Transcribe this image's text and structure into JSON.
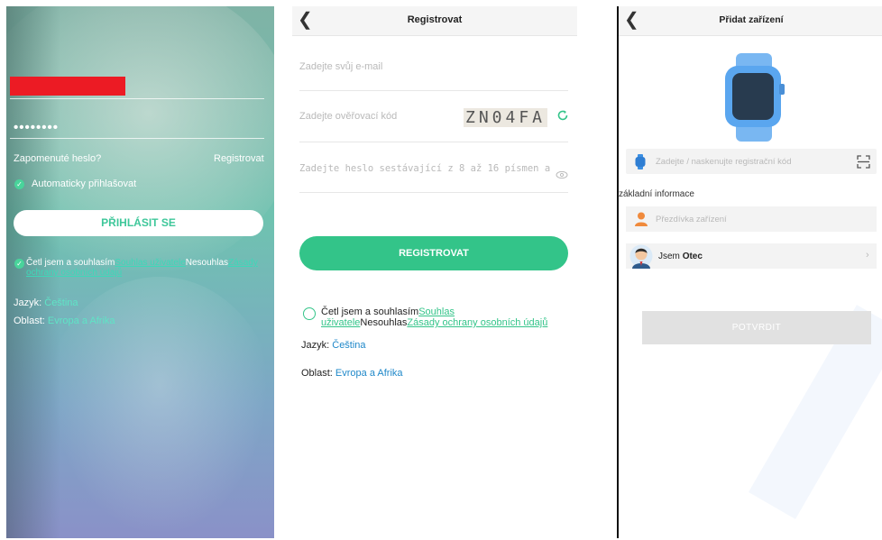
{
  "login": {
    "password_mask": "••••••••",
    "forgot_password": "Zapomenuté heslo?",
    "register_link": "Registrovat",
    "auto_login": "Automaticky přihlašovat",
    "login_button": "PŘIHLÁSIT SE",
    "agree_prefix": "Četl jsem a souhlasím",
    "agree_link1": "Souhlas uživatele",
    "agree_mid": "Nesouhlas",
    "agree_link2": "Zásady ochrany osobních údajů",
    "language_label": "Jazyk:",
    "language_value": "Čeština",
    "region_label": "Oblast:",
    "region_value": "Evropa a Afrika"
  },
  "register": {
    "title": "Registrovat",
    "email_placeholder": "Zadejte svůj e-mail",
    "code_placeholder": "Zadejte ověřovací kód",
    "captcha": "ZN04FA",
    "password_placeholder": "Zadejte heslo sestávající z 8 až 16 písmen a",
    "register_button": "REGISTROVAT",
    "agree_prefix": "Četl jsem a souhlasím",
    "agree_link1": "Souhlas uživatele",
    "agree_mid": "Nesouhlas",
    "agree_link2": "Zásady ochrany osobních údajů",
    "language_label": "Jazyk:",
    "language_value": "Čeština",
    "region_label": "Oblast:",
    "region_value": "Evropa a Afrika"
  },
  "add_device": {
    "title": "Přidat zařízení",
    "code_placeholder": "Zadejte / naskenujte registrační kód",
    "section_label": "základní informace",
    "nickname_placeholder": "Přezdívka zařízení",
    "relation_prefix": "Jsem",
    "relation_value": "Otec",
    "confirm_button": "POTVRDIT"
  },
  "colors": {
    "accent_green": "#33c489",
    "link_blue": "#1f88c9",
    "redaction": "#ec1b24"
  }
}
